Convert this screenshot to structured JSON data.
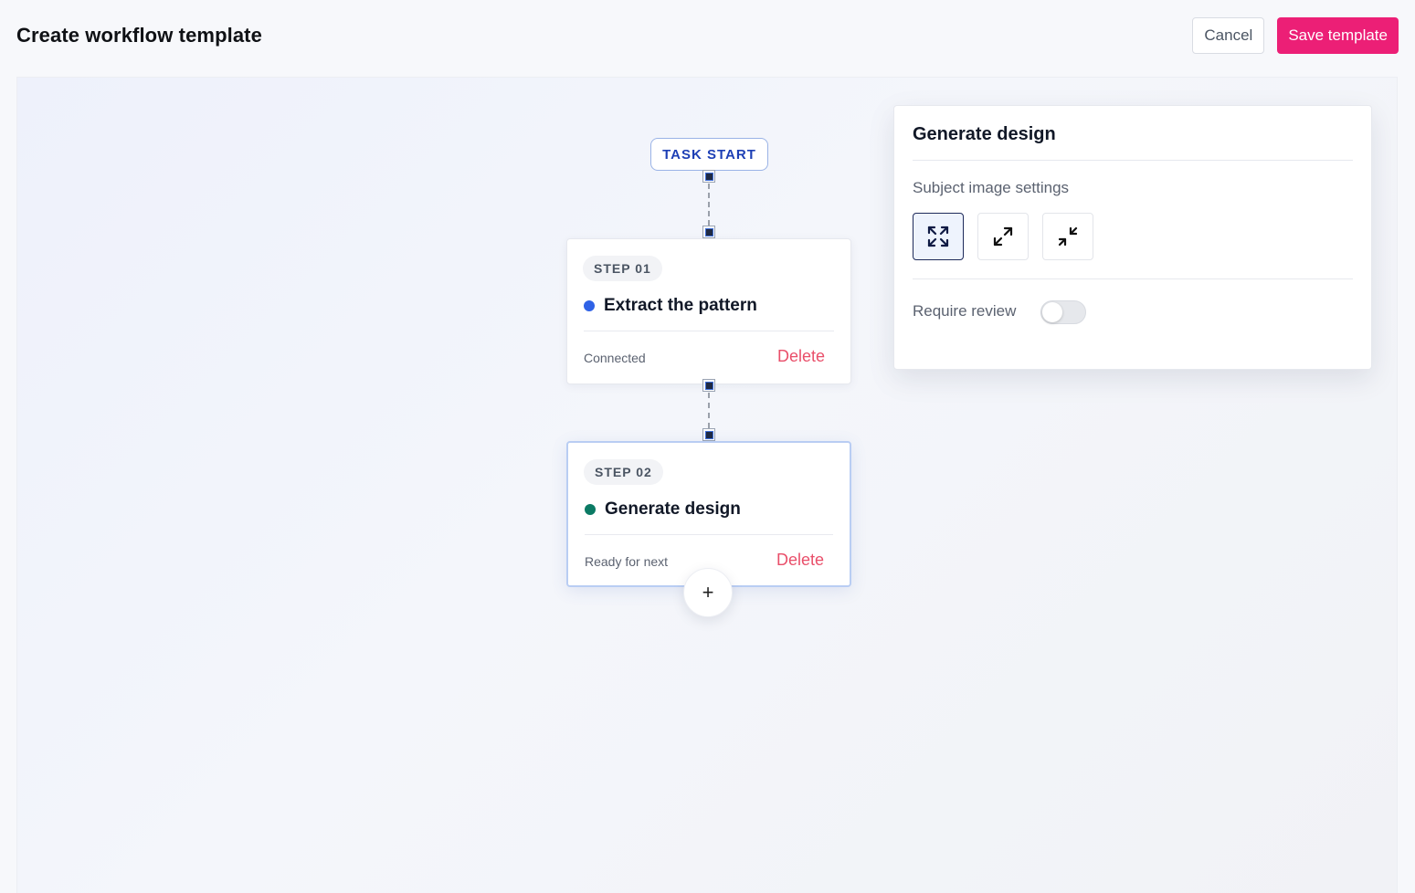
{
  "header": {
    "title": "Create workflow template",
    "cancel_label": "Cancel",
    "save_label": "Save template"
  },
  "canvas": {
    "task_start_label": "TASK START",
    "steps": [
      {
        "badge": "STEP 01",
        "title": "Extract the pattern",
        "status": "Connected",
        "delete_label": "Delete",
        "dot_color": "#2f62e6"
      },
      {
        "badge": "STEP 02",
        "title": "Generate design",
        "status": "Ready for next",
        "delete_label": "Delete",
        "dot_color": "#0b7a64"
      }
    ],
    "add_step_label": "+"
  },
  "panel": {
    "title": "Generate design",
    "subject_label": "Subject image settings",
    "modes": [
      {
        "icon": "fit-expand-icon",
        "active": true
      },
      {
        "icon": "expand-diagonal-icon",
        "active": false
      },
      {
        "icon": "collapse-diagonal-icon",
        "active": false
      }
    ],
    "review_label": "Require review",
    "review_enabled": false
  },
  "colors": {
    "accent": "#ec1f76",
    "delete": "#e94f6a",
    "start_text": "#1d3fb5"
  }
}
